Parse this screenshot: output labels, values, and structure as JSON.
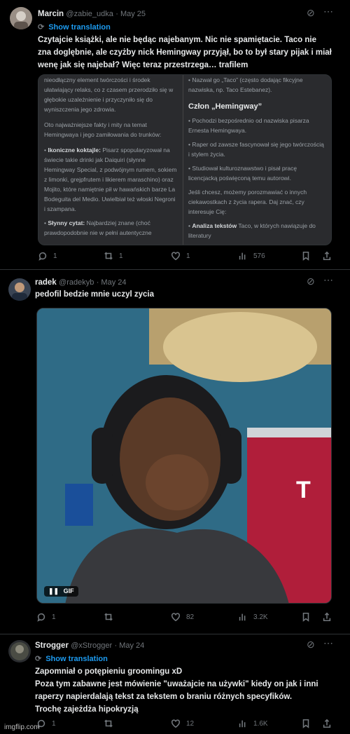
{
  "tweets": [
    {
      "name": "Marcin",
      "handle": "@zabie_udka",
      "date": "May 25",
      "translate": "Show translation",
      "text": "Czytajcie książki, ale nie będąc najebanym. Nic nie spamiętacie. Taco nie zna doglębnie, ale czyżby nick Hemingway przyjął, bo to był stary pijak i miał wenę jak się najebał? Więc teraz przestrzega… trafilem",
      "media_left": {
        "p1": "nieodłączny element twórczości i środek ułatwiający relaks, co z czasem przerodziło się w głębokie uzależnienie i przyczyniło się do wyniszczenia jego zdrowia.",
        "p2": "Oto najważniejsze fakty i mity na temat Hemingwaya i jego zamiłowania do trunków:",
        "b1_title": "Ikoniczne koktajle:",
        "b1_text": "Pisarz spopularyzował na świecie takie drinki jak Daiquiri (słynne Hemingway Special, z podwójnym rumem, sokiem z limonki, grejpfrutem i likierem maraschino) oraz Mojito, które namiętnie pił w hawańskich barze La Bodeguita del Medio. Uwielbiał też włoski Negroni i szampana.",
        "b2_title": "Słynny cytat:",
        "b2_text": "Najbardziej znane (choć prawdopodobnie nie w pełni autentyczne"
      },
      "media_right": {
        "top": "Nazwał go „Taco” (często dodając fikcyjne nazwiska, np. Taco Estebanez).",
        "heading": "Człon „Hemingway”",
        "b1": "Pochodzi bezpośrednio od nazwiska pisarza Ernesta Hemingwaya.",
        "b2": "Raper od zawsze fascynował się jego twórczością i stylem życia.",
        "b3": "Studiował kulturoznawstwo i pisał pracę licencjacką poświęconą temu autorowi.",
        "p1": "Jeśli chcesz, możemy porozmawiać o innych ciekawostkach z życia rapera. Daj znać, czy interesuje Cię:",
        "b4_title": "Analiza tekstów",
        "b4_text": "Taco, w których nawiązuje do literatury"
      },
      "stats": {
        "replies": "1",
        "retweets": "1",
        "likes": "1",
        "views": "576"
      }
    },
    {
      "name": "radek",
      "handle": "@radekyb",
      "date": "May 24",
      "text": "pedofil bedzie mnie uczyl zycia",
      "gif_label": "GIF",
      "overlay_text": "T",
      "stats": {
        "replies": "1",
        "retweets": "",
        "likes": "82",
        "views": "3.2K"
      }
    },
    {
      "name": "Strogger",
      "handle": "@xStrogger",
      "date": "May 24",
      "translate": "Show translation",
      "text_lines": [
        "Zapomniał o potępieniu groomingu xD",
        "Poza tym zabawne jest mówienie \"uważajcie na używki\" kiedy on jak i inni raperzy napierdalają tekst za tekstem o braniu różnych specyfików.",
        "Trochę zajeżdża hipokryzją"
      ],
      "stats": {
        "replies": "1",
        "retweets": "",
        "likes": "12",
        "views": "1.6K"
      }
    }
  ],
  "watermark": "imgflip.com"
}
